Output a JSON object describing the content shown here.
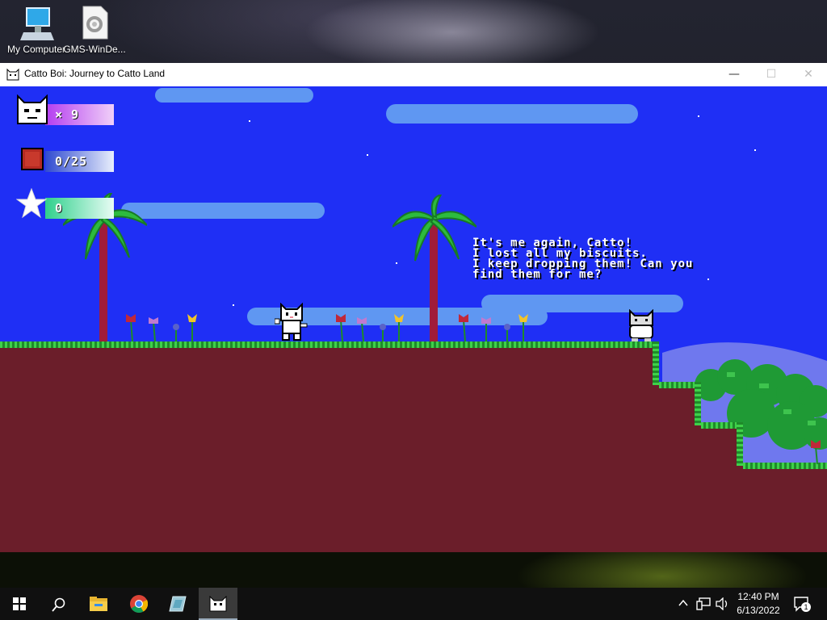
{
  "desktop": {
    "icons": [
      {
        "label": "My Computer",
        "icon": "computer-icon"
      },
      {
        "label": "GMS-WinDe...",
        "icon": "settings-file-icon"
      }
    ]
  },
  "window": {
    "title": "Catto Boi: Journey to Catto Land",
    "minimize": "—",
    "maximize": "☐",
    "close": "✕"
  },
  "game": {
    "hud": {
      "lives": "× 9",
      "biscuits": "0/25",
      "stars": "0"
    },
    "dialog": [
      "It's me again, Catto!",
      "I lost all my biscuits.",
      "I keep dropping them! Can you",
      "find them for me?"
    ],
    "colors": {
      "sky": "#1f2ff5",
      "ground": "#6b1e2a",
      "grass": "#3fd14a",
      "cloud": "#5f97f2"
    }
  },
  "taskbar": {
    "apps": [
      "start-icon",
      "search-icon",
      "file-explorer-icon",
      "chrome-icon",
      "gamemaker-icon",
      "catto-game-icon"
    ],
    "time": "12:40 PM",
    "date": "6/13/2022",
    "notifications": "1"
  }
}
